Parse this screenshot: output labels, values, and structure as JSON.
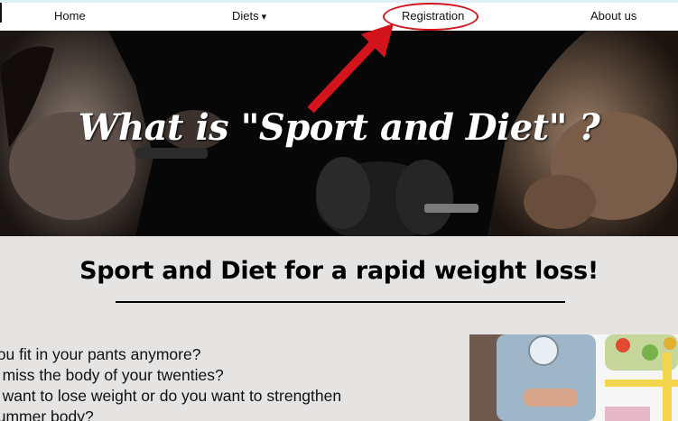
{
  "nav": {
    "home": "Home",
    "diets": "Diets",
    "diets_caret": "▾",
    "registration": "Registration",
    "about": "About us"
  },
  "hero": {
    "title": "What is \"Sport and Diet\" ?"
  },
  "content": {
    "headline": "Sport and Diet for a rapid weight loss!",
    "lines": [
      "you fit in your pants anymore?",
      "u miss the body of your twenties?",
      "u want to lose weight or do you want to strengthen",
      "summer body?"
    ]
  },
  "colors": {
    "annotation_red": "#d4141c",
    "nav_bg": "#ffffff",
    "page_bg": "#e6e3e3",
    "hero_bg": "#070707"
  }
}
